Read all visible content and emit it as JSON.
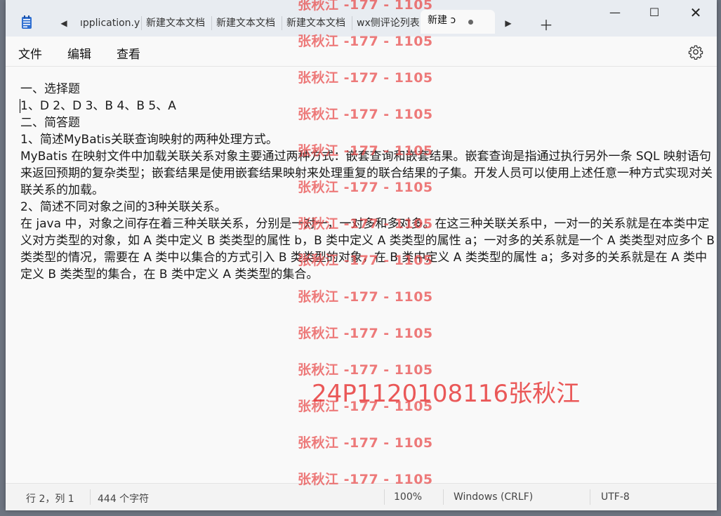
{
  "tabs": [
    {
      "label": "ıpplication.y"
    },
    {
      "label": "新建文本文档"
    },
    {
      "label": "新建文本文档"
    },
    {
      "label": "新建文本文档"
    },
    {
      "label": "wx侧评论列表"
    },
    {
      "label": "新建 ↄ"
    }
  ],
  "menu": {
    "file": "文件",
    "edit": "编辑",
    "view": "查看"
  },
  "document": {
    "text": "一、选择题\n1、D 2、D 3、B 4、B 5、A\n二、简答题\n1、简述MyBatis关联查询映射的两种处理方式。\nMyBatis 在映射文件中加载关联关系对象主要通过两种方式：嵌套查询和嵌套结果。嵌套查询是指通过执行另外一条 SQL 映射语句来返回预期的复杂类型；嵌套结果是使用嵌套结果映射来处理重复的联合结果的子集。开发人员可以使用上述任意一种方式实现对关联关系的加载。\n2、简述不同对象之间的3种关联关系。\n在 java 中，对象之间存在着三种关联关系，分别是一对一，一对多和多对多。在这三种关联关系中，一对一的关系就是在本类中定义对方类型的对象，如 A 类中定义 B 类类型的属性 b，B 类中定义 A 类类型的属性 a；一对多的关系就是一个 A 类类型对应多个 B 类类型的情况，需要在 A 类中以集合的方式引入 B 类类型的对象，在 B 类中定义 A 类类型的属性 a；多对多的关系就是在 A 类中定义 B 类类型的集合，在 B 类中定义 A 类类型的集合。"
  },
  "status": {
    "position": "行 2，列 1",
    "chars": "444 个字符",
    "zoom": "100%",
    "line_ending": "Windows (CRLF)",
    "encoding": "UTF-8"
  },
  "watermark": {
    "repeat": "张秋江 -177 - 1105",
    "id": "24P1120108116张秋江"
  },
  "colors": {
    "watermark": "#e84646",
    "titlebar": "#e8ecf1",
    "background": "#f9f9f9"
  }
}
